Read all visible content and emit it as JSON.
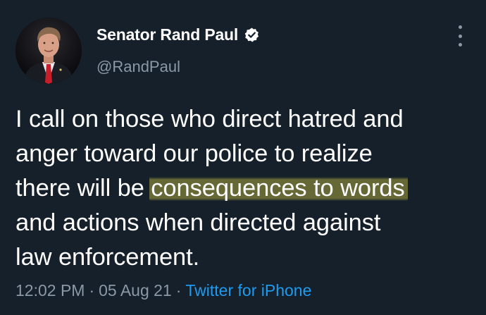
{
  "author": {
    "display_name": "Senator Rand Paul",
    "handle": "@RandPaul",
    "verified_icon": "verified-badge-icon",
    "avatar_icon": "avatar"
  },
  "tweet": {
    "lines": [
      "I call on those who direct hatred and",
      "anger toward our police to realize",
      "there will be ",
      "and actions when directed against",
      "law enforcement."
    ],
    "highlighted_text": "consequences to words"
  },
  "meta": {
    "time": "12:02 PM",
    "separator": "·",
    "date": "05 Aug 21",
    "source": "Twitter for iPhone"
  },
  "colors": {
    "background": "#15202b",
    "text": "#ffffff",
    "secondary": "#8b98a5",
    "link": "#1d9bf0",
    "highlight": "#d6cd46"
  }
}
